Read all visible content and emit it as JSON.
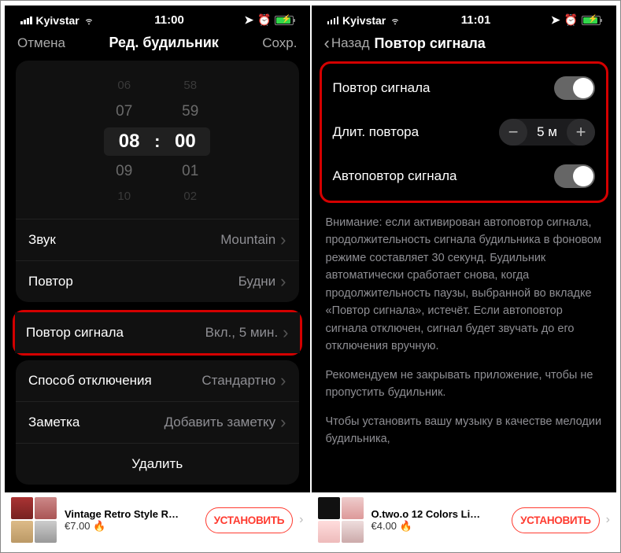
{
  "left": {
    "status": {
      "carrier": "Kyivstar",
      "time": "11:00"
    },
    "nav": {
      "cancel": "Отмена",
      "title": "Ред. будильник",
      "save": "Сохр."
    },
    "picker": {
      "h_m2": "06",
      "h_m1": "07",
      "h_sel": "08",
      "h_p1": "09",
      "h_p2": "10",
      "m_m2": "58",
      "m_m1": "59",
      "m_sel": "00",
      "m_p1": "01",
      "m_p2": "02",
      "colon": ":"
    },
    "rows": {
      "sound_label": "Звук",
      "sound_value": "Mountain",
      "repeat_label": "Повтор",
      "repeat_value": "Будни",
      "snooze_label": "Повтор сигнала",
      "snooze_value": "Вкл., 5 мин.",
      "dismiss_label": "Способ отключения",
      "dismiss_value": "Стандартно",
      "note_label": "Заметка",
      "note_placeholder": "Добавить заметку"
    },
    "delete": "Удалить",
    "ad": {
      "title": "Vintage Retro Style R…",
      "price": "€7.00 🔥",
      "cta": "УСТАНОВИТЬ"
    }
  },
  "right": {
    "status": {
      "carrier": "Kyivstar",
      "time": "11:01"
    },
    "nav": {
      "back": "Назад",
      "title": "Повтор сигнала"
    },
    "settings": {
      "snooze_label": "Повтор сигнала",
      "duration_label": "Длит. повтора",
      "duration_value": "5 м",
      "auto_label": "Автоповтор сигнала"
    },
    "info": {
      "p1": "Внимание: если активирован автоповтор сигнала, продолжительность сигнала будильника в фоновом режиме составляет 30 секунд. Будильник автоматически сработает снова, когда продолжительность паузы, выбранной во вкладке «Повтор сигнала», истечёт. Если автоповтор сигнала отключен, сигнал будет звучать до его отключения вручную.",
      "p2": "Рекомендуем не закрывать приложение, чтобы не пропустить будильник.",
      "p3": "Чтобы установить вашу музыку в качестве мелодии будильника,"
    },
    "ad": {
      "title": "O.two.o 12 Colors Li…",
      "price": "€4.00 🔥",
      "cta": "УСТАНОВИТЬ"
    }
  }
}
